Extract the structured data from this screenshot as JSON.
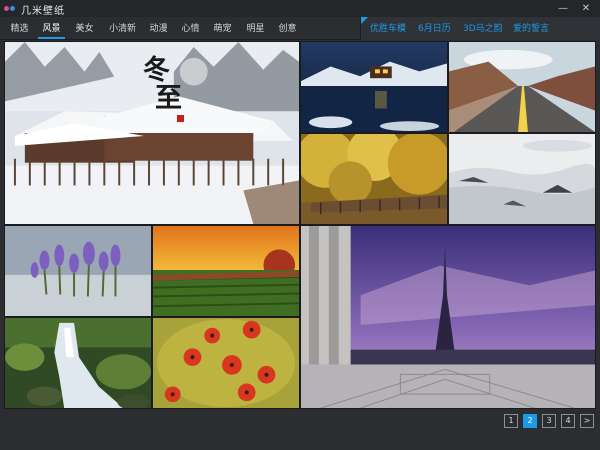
{
  "app": {
    "title": "几米壁纸"
  },
  "window": {
    "minimize": "—",
    "close": "✕"
  },
  "nav": {
    "items": [
      {
        "label": "精选",
        "active": false
      },
      {
        "label": "风景",
        "active": true
      },
      {
        "label": "美女",
        "active": false
      },
      {
        "label": "小清新",
        "active": false
      },
      {
        "label": "动漫",
        "active": false
      },
      {
        "label": "心情",
        "active": false
      },
      {
        "label": "萌宠",
        "active": false
      },
      {
        "label": "明星",
        "active": false
      },
      {
        "label": "创意",
        "active": false
      }
    ],
    "special": [
      {
        "label": "优胜车模"
      },
      {
        "label": "6月日历"
      },
      {
        "label": "3D马之韵"
      },
      {
        "label": "爱的誓言"
      }
    ]
  },
  "gallery": {
    "featured": {
      "calligraphy_line1": "冬",
      "calligraphy_line2": "至"
    },
    "tiles": [
      {
        "name": "winter-village"
      },
      {
        "name": "lake-cabin-night"
      },
      {
        "name": "desert-road"
      },
      {
        "name": "autumn-trees"
      },
      {
        "name": "sea-of-clouds"
      },
      {
        "name": "crocus-flowers"
      },
      {
        "name": "field-sunset"
      },
      {
        "name": "eiffel-tower-dusk"
      },
      {
        "name": "stream-waterfall"
      },
      {
        "name": "red-flowers"
      }
    ]
  },
  "pagination": {
    "pages": [
      {
        "label": "1",
        "active": false
      },
      {
        "label": "2",
        "active": true
      },
      {
        "label": "3",
        "active": false
      },
      {
        "label": "4",
        "active": false
      }
    ],
    "next": ">"
  }
}
